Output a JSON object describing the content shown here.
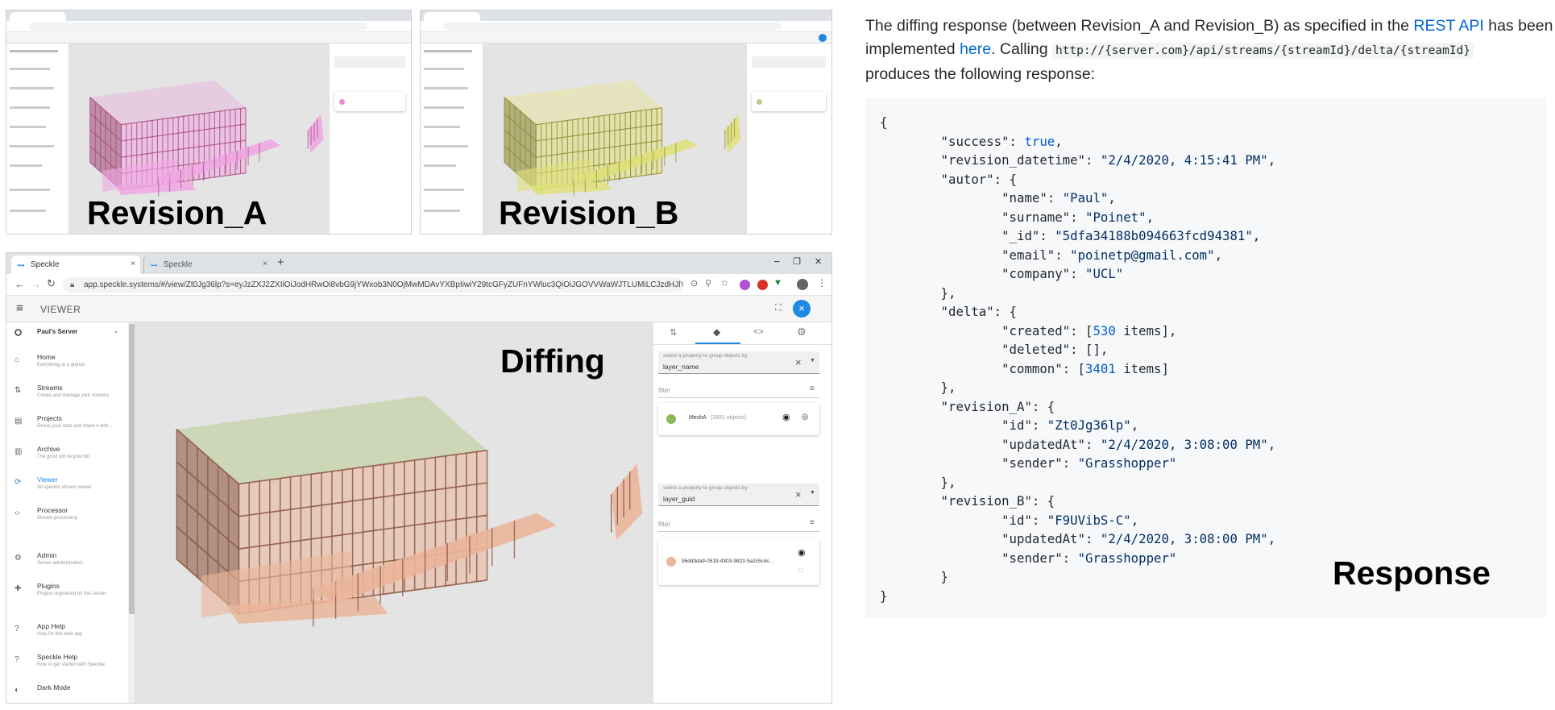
{
  "labels": {
    "revision_a": "Revision_A",
    "revision_b": "Revision_B",
    "diffing": "Diffing",
    "response": "Response"
  },
  "colors": {
    "revision_a_model": "#e88bd4",
    "revision_b_model": "#d3d35a",
    "diff_model_new": "#b8d08a",
    "diff_model_common": "#e8b79a",
    "accent": "#1e88e5",
    "link": "#0366d6"
  },
  "browser": {
    "tab_active_title": "Speckle",
    "tab_inactive_title": "Speckle",
    "url": "app.speckle.systems/#/view/Zt0Jg36lp?s=eyJzZXJ2ZXIiOiJodHRwOi8vbG9jYWxob3N0OjMwMDAvYXBpIiwiY29tcGFyZUFnYWluc3QiOiJGOVVWaWJTLUMiLCJzdHJlYW1JZCI6IlZ0MGpnMzZscCJ9",
    "app_title": "VIEWER",
    "server_name": "Paul's Server",
    "nav": [
      {
        "label": "Home",
        "sub": "Everything at a glance",
        "icon": "home-icon"
      },
      {
        "label": "Streams",
        "sub": "Create and manage your streams",
        "icon": "streams-icon"
      },
      {
        "label": "Projects",
        "sub": "Group your data and share it with...",
        "icon": "projects-icon"
      },
      {
        "label": "Archive",
        "sub": "The good old recycle bin",
        "icon": "archive-icon"
      },
      {
        "label": "Viewer",
        "sub": "3d speckle stream viewer",
        "icon": "viewer-icon"
      },
      {
        "label": "Processor",
        "sub": "Stream processing",
        "icon": "processor-icon"
      },
      {
        "label": "Admin",
        "sub": "Server administration",
        "icon": "admin-icon"
      },
      {
        "label": "Plugins",
        "sub": "Plugins registered on this server",
        "icon": "plugins-icon"
      },
      {
        "label": "App Help",
        "sub": "Help for this web app",
        "icon": "help-icon"
      },
      {
        "label": "Speckle Help",
        "sub": "How to get started with Speckle",
        "icon": "speckle-help-icon"
      },
      {
        "label": "Dark Mode",
        "sub": "",
        "icon": "dark-mode-icon"
      }
    ],
    "panel": {
      "group1_hint": "select a property to group objects by",
      "group1_value": "layer_name",
      "filter1": "filter",
      "layer1_label": "MeshA",
      "layer1_count": "(3931 objects)",
      "group2_hint": "select a property to group objects by",
      "group2_value": "layer_guid",
      "filter2": "filter",
      "layer2_label": "96dd3da9-0519-4303-9823-5a2c5c4c..."
    }
  },
  "article": {
    "p1_a": "The diffing response (between Revision_A and Revision_B) as specified in the ",
    "link_rest": "REST API",
    "p1_b": " has been",
    "p2_a": "implemented ",
    "link_here": "here",
    "p2_b": ". Calling ",
    "endpoint": "http://{server.com}/api/streams/{streamId}/delta/{streamId}",
    "p3": "produces the following response:",
    "code_lines": [
      "{",
      "        \"success\": true,",
      "        \"revision_datetime\": \"2/4/2020, 4:15:41 PM\",",
      "        \"autor\": {",
      "                \"name\": \"Paul\",",
      "                \"surname\": \"Poinet\",",
      "                \"_id\": \"5dfa34188b094663fcd94381\",",
      "                \"email\": \"poinetp@gmail.com\",",
      "                \"company\": \"UCL\"",
      "        },",
      "        \"delta\": {",
      "                \"created\": [530 items],",
      "                \"deleted\": [],",
      "                \"common\": [3401 items]",
      "        },",
      "        \"revision_A\": {",
      "                \"id\": \"Zt0Jg36lp\",",
      "                \"updatedAt\": \"2/4/2020, 3:08:00 PM\",",
      "                \"sender\": \"Grasshopper\"",
      "        },",
      "        \"revision_B\": {",
      "                \"id\": \"F9UVibS-C\",",
      "                \"updatedAt\": \"2/4/2020, 3:08:00 PM\",",
      "                \"sender\": \"Grasshopper\"",
      "        }",
      "}"
    ]
  }
}
